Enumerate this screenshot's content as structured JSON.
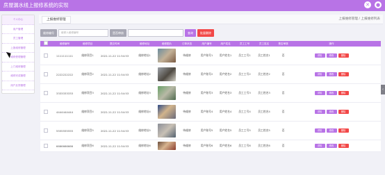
{
  "app": {
    "title": "房屋漏水线上报修系统的实现"
  },
  "sidebar": {
    "items": [
      "个人中心",
      "用户管理",
      "员工管理",
      "上报维修管理",
      "维修受理管理",
      "上门维修管理",
      "维修完成管理",
      "用户反馈管理"
    ]
  },
  "tab": {
    "label": "上报维修管理"
  },
  "crumb": {
    "text": "上报维修管理 / 上报维修列表"
  },
  "toolbar": {
    "label": "维修编号",
    "input_placeholder": "维修人维修编号",
    "label2": "是否审核",
    "query": "查询",
    "delete": "批量删除"
  },
  "table": {
    "headers": [
      "",
      "维修编号",
      "维修项目",
      "提交时间",
      "维修地址",
      "维修图片",
      "订单状态",
      "用户编号",
      "用户姓名",
      "员工工号",
      "员工姓名",
      "是否审核",
      "操作"
    ],
    "rows": [
      {
        "id": "1111111111",
        "item": "维修项目1",
        "time": "2022-11-22 11:54:53",
        "addr": "维修地址1",
        "status": "待维修",
        "user": "用户账号1",
        "uname": "用户姓名1",
        "staff": "员工工号1",
        "sname": "员工姓名1",
        "audit": "否"
      },
      {
        "id": "2222222222",
        "item": "维修项目2",
        "time": "2022-11-22 11:54:53",
        "addr": "维修地址2",
        "status": "待维修",
        "user": "用户账号2",
        "uname": "用户姓名2",
        "staff": "员工工号2",
        "sname": "员工姓名2",
        "audit": "否"
      },
      {
        "id": "3333333333",
        "item": "维修项目3",
        "time": "2022-11-22 11:54:53",
        "addr": "维修地址3",
        "status": "待维修",
        "user": "用户账号3",
        "uname": "用户姓名3",
        "staff": "员工工号3",
        "sname": "员工姓名3",
        "audit": "否"
      },
      {
        "id": "4444444444",
        "item": "维修项目4",
        "time": "2022-11-22 11:54:53",
        "addr": "维修地址4",
        "status": "待维修",
        "user": "用户账号4",
        "uname": "用户姓名4",
        "staff": "员工工号4",
        "sname": "员工姓名4",
        "audit": "否"
      },
      {
        "id": "5555555555",
        "item": "维修项目5",
        "time": "2022-11-22 11:54:53",
        "addr": "维修地址5",
        "status": "待维修",
        "user": "用户账号5",
        "uname": "用户姓名5",
        "staff": "员工工号5",
        "sname": "员工姓名5",
        "audit": "否"
      },
      {
        "id": "6666666666",
        "item": "维修项目6",
        "time": "2022-11-22 11:54:53",
        "addr": "维修地址6",
        "status": "待维修",
        "user": "用户账号6",
        "uname": "用户姓名6",
        "staff": "员工工号6",
        "sname": "员工姓名6",
        "audit": "否"
      }
    ],
    "actions": [
      "详情",
      "修改",
      "删除"
    ]
  },
  "colors": {
    "accent": "#b873e6",
    "danger": "#f24848"
  },
  "icons": {
    "logout": "close-icon",
    "user": "user-icon"
  }
}
